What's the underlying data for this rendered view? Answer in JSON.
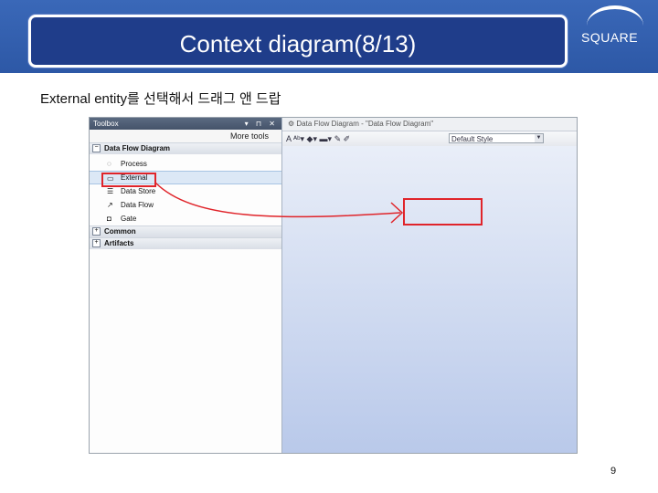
{
  "slide": {
    "title": "Context diagram(8/13)",
    "logo_text": "SQUARE",
    "subtitle": "External entity를 선택해서 드래그 앤 드랍",
    "page_number": "9"
  },
  "toolbox": {
    "title": "Toolbox",
    "controls": "▾ ⊓ ✕",
    "more_tools": "More tools",
    "group_dfd": "Data Flow Diagram",
    "items": [
      {
        "label": "Process",
        "icon": "process-icon"
      },
      {
        "label": "External",
        "icon": "external-entity-icon"
      },
      {
        "label": "Data Store",
        "icon": "data-store-icon"
      },
      {
        "label": "Data Flow",
        "icon": "data-flow-icon"
      },
      {
        "label": "Gate",
        "icon": "gate-icon"
      }
    ],
    "group_common": "Common",
    "group_artifacts": "Artifacts"
  },
  "editor": {
    "tab_label": "Data Flow Diagram - \"Data Flow Diagram\"",
    "style_value": "Default Style"
  },
  "colors": {
    "highlight": "#e0242a",
    "title_band": "#1f3d8a"
  }
}
